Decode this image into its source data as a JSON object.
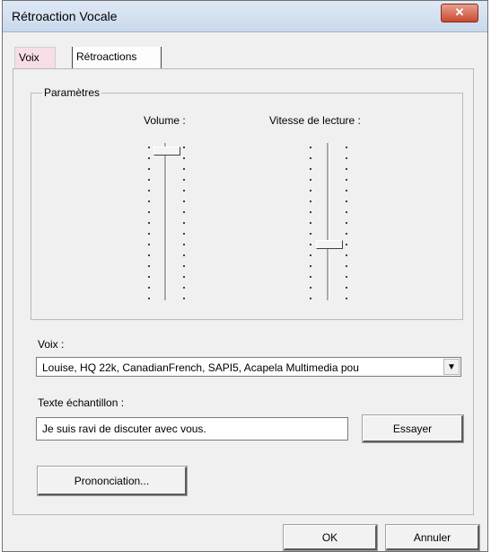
{
  "window": {
    "title": "Rétroaction Vocale",
    "close_label": "✕"
  },
  "tabs": [
    {
      "label": "Voix",
      "selected": true
    },
    {
      "label": "Rétroactions",
      "selected": false
    }
  ],
  "parametres": {
    "title": "Paramètres",
    "volume_label": "Volume :",
    "speed_label": "Vitesse de lecture :",
    "volume_level": 1.0,
    "speed_level": 0.35
  },
  "voix": {
    "label": "Voix :",
    "selected": "Louise, HQ 22k, CanadianFrench, SAPI5, Acapela Multimedia pou"
  },
  "sample": {
    "label": "Texte échantillon :",
    "value": "Je suis ravi de discuter avec vous.",
    "try_label": "Essayer"
  },
  "pronunciation_label": "Prononciation...",
  "footer": {
    "ok_label": "OK",
    "cancel_label": "Annuler"
  }
}
